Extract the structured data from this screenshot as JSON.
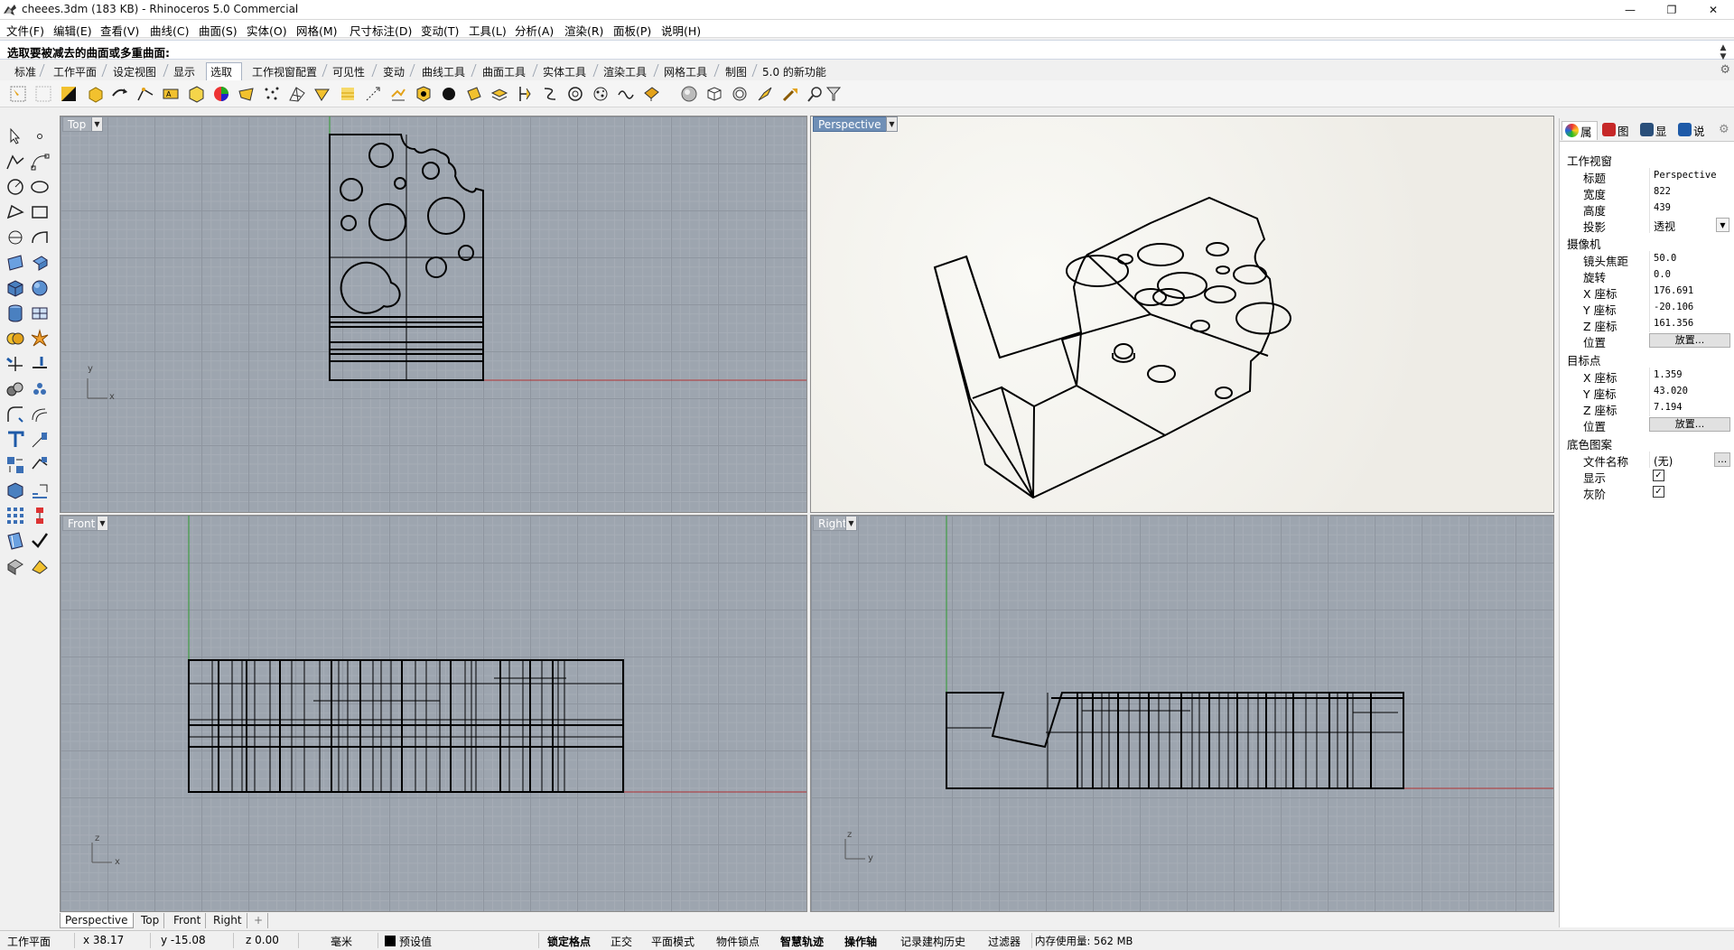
{
  "window": {
    "title": "cheees.3dm (183 KB) - Rhinoceros 5.0 Commercial",
    "minimize": "—",
    "restore": "❐",
    "close": "✕"
  },
  "menu": [
    "文件(F)",
    "编辑(E)",
    "查看(V)",
    "曲线(C)",
    "曲面(S)",
    "实体(O)",
    "网格(M)",
    "尺寸标注(D)",
    "变动(T)",
    "工具(L)",
    "分析(A)",
    "渲染(R)",
    "面板(P)",
    "说明(H)"
  ],
  "command": {
    "prompt": "选取要被减去的曲面或多重曲面:"
  },
  "toolbar_tabs": [
    "标准",
    "工作平面",
    "设定视图",
    "显示",
    "选取",
    "工作视窗配置",
    "可见性",
    "变动",
    "曲线工具",
    "曲面工具",
    "实体工具",
    "渲染工具",
    "网格工具",
    "制图",
    "5.0 的新功能"
  ],
  "active_toolbar_tab": "选取",
  "toolbar_icons": [
    "select-all-icon",
    "select-none-icon",
    "invert-selection-icon",
    "select-last-icon",
    "select-previous-icon",
    "select-curves-icon",
    "select-text-icon",
    "select-surfaces-icon",
    "select-by-color-icon",
    "select-polysurfaces-icon",
    "select-points-icon",
    "select-meshes-icon",
    "select-lights-icon",
    "select-annotations-icon",
    "select-blocks-icon",
    "select-hatches-icon",
    "select-bad-objects-icon",
    "select-closed-icon",
    "select-open-icon",
    "select-dups-icon",
    "select-lines-icon",
    "select-polylines-icon",
    "select-circles-icon",
    "select-arcs-icon",
    "select-spheres-icon",
    "select-boxes-icon",
    "select-cylinders-icon",
    "select-names-icon",
    "select-points-cloud-icon",
    "select-lasso-icon",
    "select-filter-icon"
  ],
  "viewports": {
    "top": {
      "label": "Top",
      "axis_x": "x",
      "axis_y": "y"
    },
    "perspective": {
      "label": "Perspective"
    },
    "front": {
      "label": "Front",
      "axis_x": "x",
      "axis_y": "z"
    },
    "right": {
      "label": "Right",
      "axis_x": "y",
      "axis_y": "z"
    }
  },
  "viewport_tabs": [
    "Perspective",
    "Top",
    "Front",
    "Right"
  ],
  "active_viewport_tab": "Perspective",
  "add_viewport_tab": "+",
  "panel_tabs": [
    {
      "label": "属",
      "icon": "properties-icon",
      "color": "#d23a3a"
    },
    {
      "label": "图",
      "icon": "layers-icon",
      "color": "#c62828"
    },
    {
      "label": "显",
      "icon": "display-icon",
      "color": "#2a4f7a"
    },
    {
      "label": "说",
      "icon": "help-icon",
      "color": "#1e5aa8"
    }
  ],
  "properties": {
    "viewport_section": "工作视窗",
    "title_key": "标题",
    "title_val": "Perspective",
    "width_key": "宽度",
    "width_val": "822",
    "height_key": "高度",
    "height_val": "439",
    "projection_key": "投影",
    "projection_val": "透视",
    "camera_section": "摄像机",
    "lens_key": "镜头焦距",
    "lens_val": "50.0",
    "rotation_key": "旋转",
    "rotation_val": "0.0",
    "cx_key": "X 座标",
    "cx_val": "176.691",
    "cy_key": "Y 座标",
    "cy_val": "-20.106",
    "cz_key": "Z 座标",
    "cz_val": "161.356",
    "cpos_key": "位置",
    "cpos_btn": "放置...",
    "target_section": "目标点",
    "tx_key": "X 座标",
    "tx_val": "1.359",
    "ty_key": "Y 座标",
    "ty_val": "43.020",
    "tz_key": "Z 座标",
    "tz_val": "7.194",
    "tpos_key": "位置",
    "tpos_btn": "放置...",
    "bg_section": "底色图案",
    "file_key": "文件名称",
    "file_val": "(无)",
    "file_btn": "...",
    "show_key": "显示",
    "show_checked": true,
    "gray_key": "灰阶",
    "gray_checked": true
  },
  "status": {
    "cplane": "工作平面",
    "x": "x 38.17",
    "y": "y -15.08",
    "z": "z 0.00",
    "units": "毫米",
    "layer": "预设值",
    "layer_color": "#000000",
    "grid_snap": "锁定格点",
    "ortho": "正交",
    "planar": "平面模式",
    "osnap": "物件锁点",
    "smarttrack": "智慧轨迹",
    "gumball": "操作轴",
    "history": "记录建构历史",
    "filter": "过滤器",
    "memory": "内存使用量: 562 MB"
  }
}
